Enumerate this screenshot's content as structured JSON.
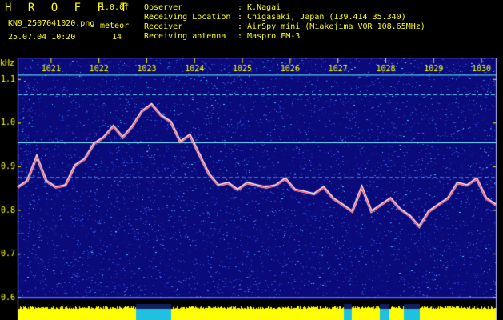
{
  "header": {
    "logo": "H R O F F T",
    "version": "1.0.0f",
    "filename": "KN9_2507041020.png",
    "program": "meteor",
    "datetime": "25.07.04 10:20",
    "count": "14",
    "info": [
      {
        "key": "Observer",
        "value": ": K.Nagai"
      },
      {
        "key": "Receiving Location",
        "value": ": Chigasaki, Japan (139.414 35.340)"
      },
      {
        "key": "Receiver",
        "value": ": AirSpy mini (Miakejima VOR 108.65MHz)"
      },
      {
        "key": "Receiving antenna",
        "value": ": Maspro FM-3"
      }
    ]
  },
  "chart_data": {
    "type": "line",
    "ylabel": "kHz",
    "ylim": [
      0.6,
      1.15
    ],
    "xlim": [
      1020.3,
      1030.3
    ],
    "x_ticks": [
      "1021",
      "1022",
      "1023",
      "1024",
      "1025",
      "1026",
      "1027",
      "1028",
      "1029",
      "1030"
    ],
    "y_ticks": [
      "0.6",
      "0.7",
      "0.8",
      "0.9",
      "1.0",
      "1.1"
    ],
    "constant_lines_khz": [
      1.11,
      1.065,
      0.955,
      0.875
    ],
    "series": [
      {
        "x": [
          1020.3,
          1020.5,
          1020.7,
          1020.9,
          1021.1,
          1021.3,
          1021.5,
          1021.7,
          1021.9,
          1022.1,
          1022.3,
          1022.5,
          1022.7,
          1022.9,
          1023.1,
          1023.3,
          1023.5,
          1023.7,
          1023.9,
          1024.1,
          1024.3,
          1024.5,
          1024.7,
          1024.9,
          1025.1,
          1025.3,
          1025.5,
          1025.7,
          1025.9,
          1026.1,
          1026.3,
          1026.5,
          1026.7,
          1026.9,
          1027.1,
          1027.3,
          1027.5,
          1027.7,
          1027.9,
          1028.1,
          1028.3,
          1028.5,
          1028.7,
          1028.9,
          1029.1,
          1029.3,
          1029.5,
          1029.7,
          1029.9,
          1030.1,
          1030.3
        ],
        "y": [
          0.85,
          0.87,
          0.92,
          0.87,
          0.85,
          0.86,
          0.9,
          0.92,
          0.95,
          0.97,
          0.99,
          0.97,
          0.99,
          1.03,
          1.04,
          1.02,
          1.0,
          0.96,
          0.97,
          0.93,
          0.88,
          0.86,
          0.86,
          0.85,
          0.86,
          0.86,
          0.85,
          0.86,
          0.87,
          0.85,
          0.84,
          0.84,
          0.85,
          0.83,
          0.81,
          0.8,
          0.85,
          0.8,
          0.81,
          0.83,
          0.8,
          0.79,
          0.76,
          0.8,
          0.81,
          0.83,
          0.86,
          0.86,
          0.87,
          0.83,
          0.81
        ]
      }
    ]
  }
}
